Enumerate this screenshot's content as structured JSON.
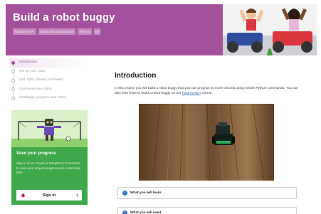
{
  "header": {
    "title": "Build a robot buggy",
    "tags": [
      "Raspberry Pi",
      "Electronic components",
      "Python",
      "EN"
    ]
  },
  "steps": [
    {
      "label": "Introduction",
      "active": true
    },
    {
      "label": "Set up your robot",
      "active": false
    },
    {
      "label": "Left, right, forward, backward",
      "active": false
    },
    {
      "label": "Customise your robot",
      "active": false
    },
    {
      "label": "Challenge: program your robot",
      "active": false
    }
  ],
  "save_card": {
    "title": "Save your progress",
    "text": "Sign in to (or create) a Raspberry Pi account to save your project progress and come back later.",
    "signin_label": "Sign in",
    "chevron": "›"
  },
  "main": {
    "heading": "Introduction",
    "paragraph_start": "In this project you will build a robot buggy that you can program to move around using simple Python commands. You can also learn how to build a robot buggy on our ",
    "paragraph_link": "FutureLearn",
    "paragraph_end": " course.",
    "accordions": [
      {
        "label": "What you will learn",
        "icon": "info-icon"
      },
      {
        "label": "What you will need",
        "icon": "info-icon"
      }
    ]
  },
  "colors": {
    "brand_purple": "#a4519d",
    "card_green": "#3ea84a",
    "link_blue": "#2f6fbf"
  }
}
